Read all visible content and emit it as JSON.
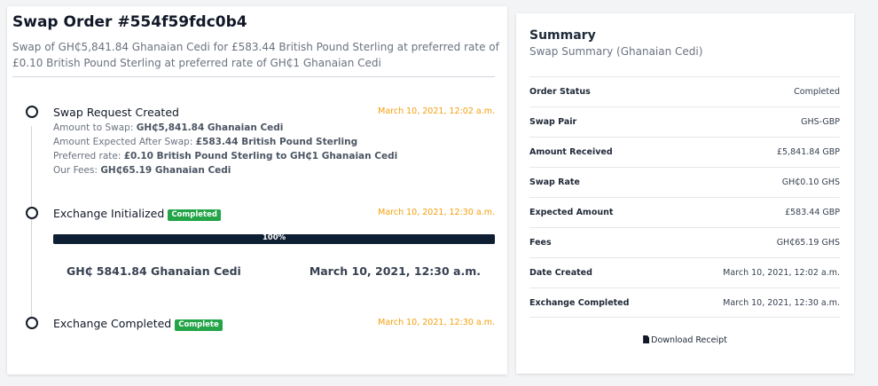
{
  "order": {
    "title": "Swap Order #554f59fdc0b4",
    "subtitle": "Swap of GH₵5,841.84 Ghanaian Cedi for £583.44 British Pound Sterling at preferred rate of £0.10 British Pound Sterling at preferred rate of GH₵1 Ghanaian Cedi"
  },
  "timeline": {
    "step1": {
      "title": "Swap Request Created",
      "time": "March 10, 2021, 12:02 a.m.",
      "details": [
        {
          "label": "Amount to Swap: ",
          "value": "GH₵5,841.84 Ghanaian Cedi"
        },
        {
          "label": "Amount Expected After Swap: ",
          "value": "£583.44 British Pound Sterling"
        },
        {
          "label": "Preferred rate: ",
          "value": "£0.10 British Pound Sterling to GH₵1 Ghanaian Cedi"
        },
        {
          "label": "Our Fees: ",
          "value": "GH₵65.19 Ghanaian Cedi"
        }
      ]
    },
    "step2": {
      "title": "Exchange Initialized",
      "badge": "Completed",
      "time": "March 10, 2021, 12:30 a.m.",
      "progress_label": "100%",
      "progress_value": 1.0,
      "amount": "GH₵ 5841.84 Ghanaian Cedi",
      "date": "March 10, 2021, 12:30 a.m."
    },
    "step3": {
      "title": "Exchange Completed",
      "badge": "Complete",
      "time": "March 10, 2021, 12:30 a.m."
    }
  },
  "summary": {
    "title": "Summary",
    "subtitle": "Swap Summary (Ghanaian Cedi)",
    "rows": [
      {
        "label": "Order Status",
        "value": "Completed"
      },
      {
        "label": "Swap Pair",
        "value": "GHS-GBP"
      },
      {
        "label": "Amount Received",
        "value": "£5,841.84 GBP"
      },
      {
        "label": "Swap Rate",
        "value": "GH₵0.10 GHS"
      },
      {
        "label": "Expected Amount",
        "value": "£583.44 GBP"
      },
      {
        "label": "Fees",
        "value": "GH₵65.19 GHS"
      },
      {
        "label": "Date Created",
        "value": "March 10, 2021, 12:02 a.m."
      },
      {
        "label": "Exchange Completed",
        "value": "March 10, 2021, 12:30 a.m."
      }
    ],
    "download_label": "Download Receipt"
  },
  "colors": {
    "accent_orange": "#f59e0b",
    "badge_green": "#22a447",
    "progress_navy": "#0f1f33"
  }
}
